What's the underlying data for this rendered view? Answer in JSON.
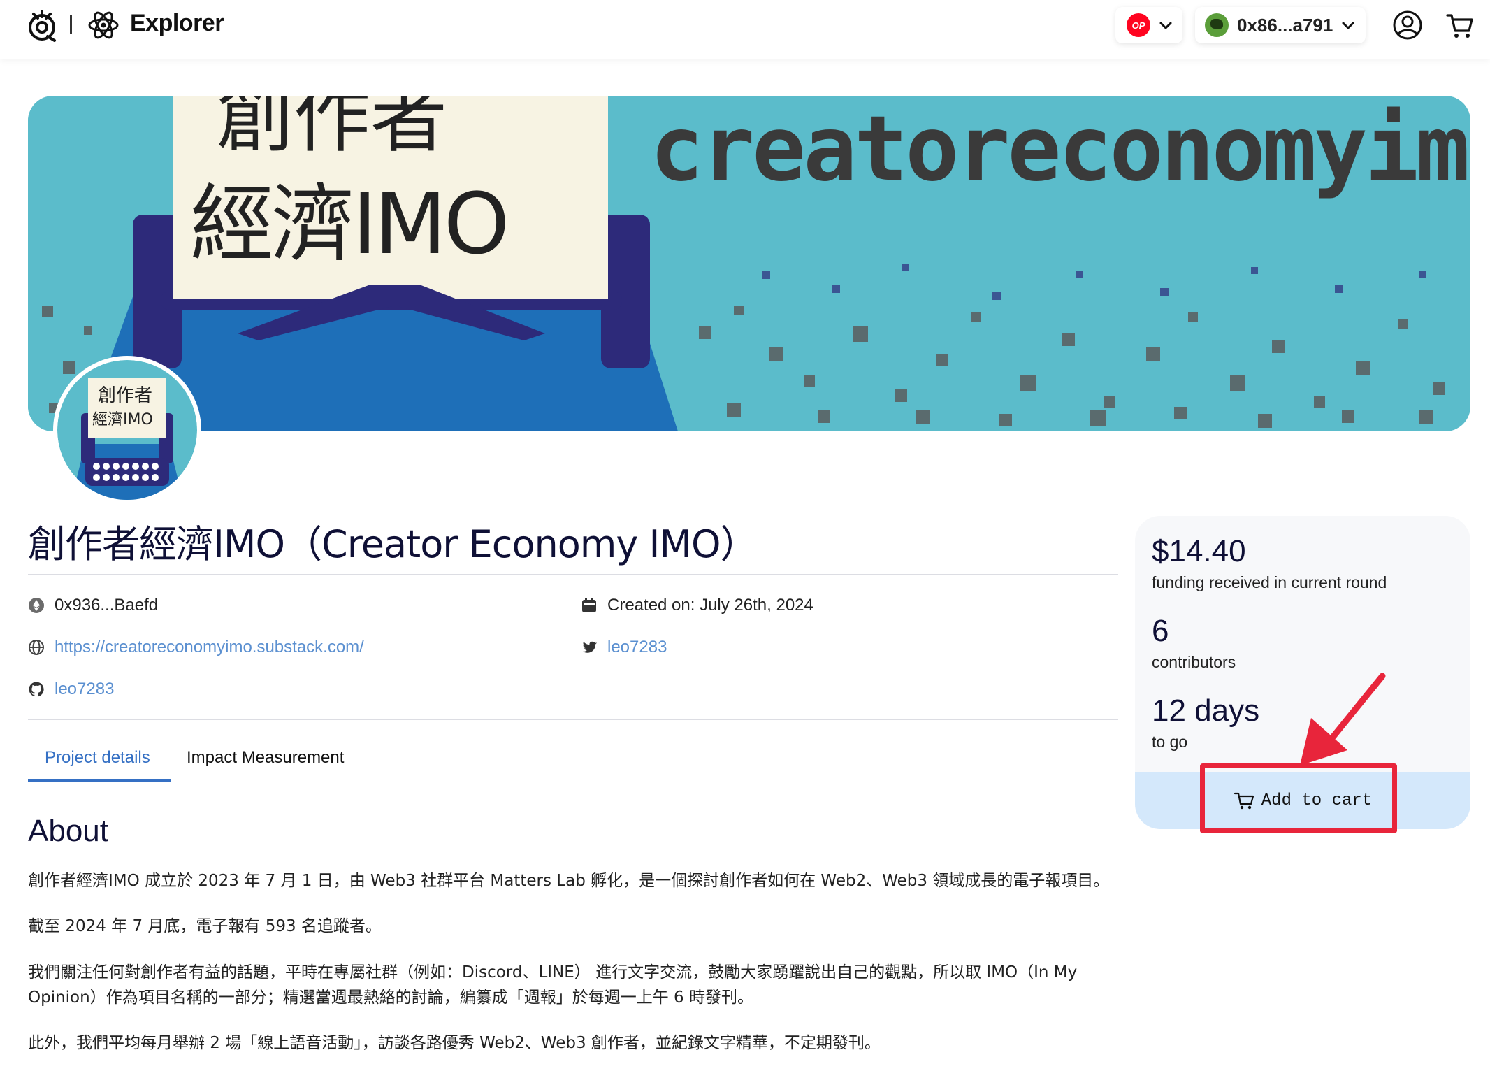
{
  "header": {
    "app_title": "Explorer",
    "network": {
      "badge": "OP",
      "icon": "optimism-icon"
    },
    "wallet": {
      "address": "0x86...a791",
      "icon": "wallet-avatar"
    },
    "icons": [
      "user-icon",
      "cart-icon"
    ]
  },
  "banner": {
    "title_line1": "創作者",
    "title_line2": "經濟IMO",
    "wordmark": "creatoreconomyimo",
    "avatar_line1": "創作者",
    "avatar_line2": "經濟IMO",
    "colors": {
      "teal": "#5bbccb",
      "navy": "#2d2a7a",
      "blue": "#1e6fb8",
      "paper": "#f7f3e3",
      "pixel_gray": "#5a6b6e"
    }
  },
  "project": {
    "title": "創作者經濟IMO（Creator Economy IMO）",
    "owner_address": "0x936...Baefd",
    "created_on": "Created on: July 26th, 2024",
    "website": "https://creatoreconomyimo.substack.com/",
    "twitter": "leo7283",
    "github": "leo7283"
  },
  "tabs": [
    {
      "label": "Project details",
      "active": true
    },
    {
      "label": "Impact Measurement",
      "active": false
    }
  ],
  "about": {
    "heading": "About",
    "paragraphs": [
      "創作者經濟IMO 成立於 2023 年 7 月 1 日，由 Web3 社群平台 Matters Lab 孵化，是一個探討創作者如何在 Web2、Web3 領域成長的電子報項目。",
      "截至 2024 年 7 月底，電子報有 593 名追蹤者。",
      "我們關注任何對創作者有益的話題，平時在專屬社群（例如：Discord、LINE） 進行文字交流，鼓勵大家踴躍說出自己的觀點，所以取 IMO（In My Opinion）作為項目名稱的一部分；精選當週最熱絡的討論，編纂成「週報」於每週一上午 6 時發刊。",
      "此外，我們平均每月舉辦 2 場「線上語音活動」，訪談各路優秀 Web2、Web3 創作者，並紀錄文字精華，不定期發刊。"
    ]
  },
  "stats": {
    "funding_value": "$14.40",
    "funding_label": "funding received in current round",
    "contributors_value": "6",
    "contributors_label": "contributors",
    "days_value": "12 days",
    "days_label": "to go",
    "add_to_cart_label": "Add to cart"
  },
  "annotation": {
    "color": "#e8253b"
  }
}
